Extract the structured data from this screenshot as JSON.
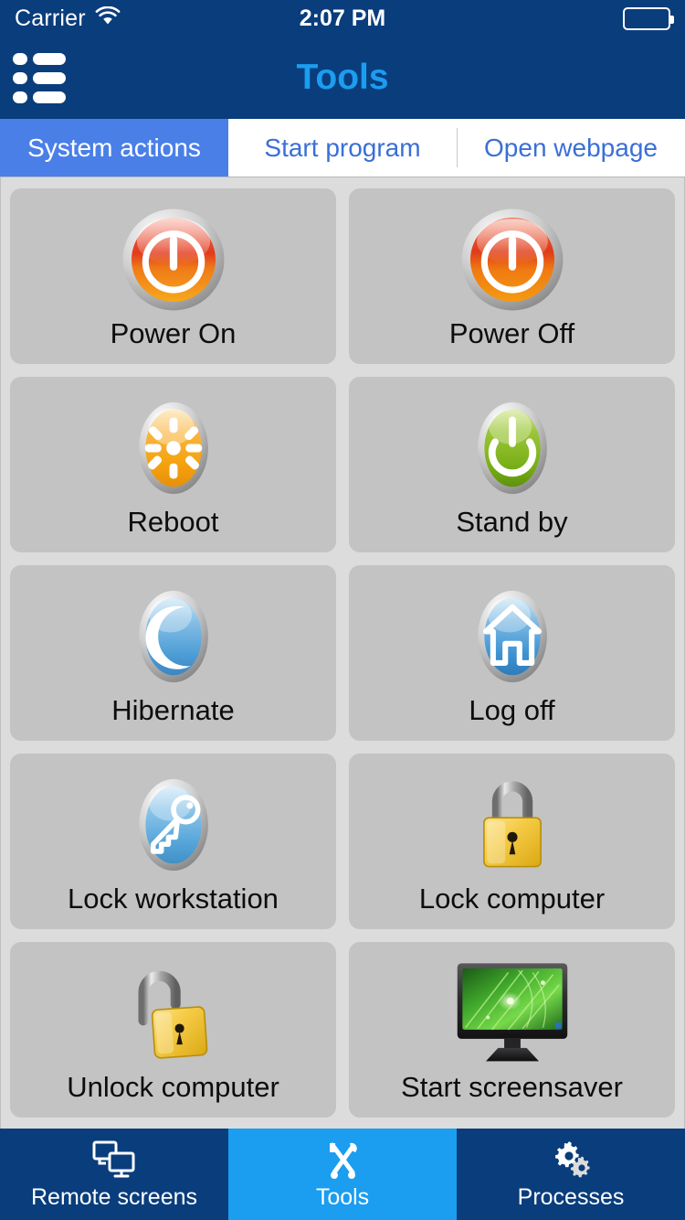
{
  "status_bar": {
    "carrier": "Carrier",
    "wifi_icon": "wifi-icon",
    "time": "2:07 PM",
    "battery_icon": "battery-full-icon"
  },
  "nav_bar": {
    "menu_icon": "list-menu-icon",
    "title": "Tools"
  },
  "segmented_tabs": {
    "active_index": 0,
    "items": [
      {
        "label": "System actions"
      },
      {
        "label": "Start program"
      },
      {
        "label": "Open webpage"
      }
    ]
  },
  "actions": [
    {
      "label": "Power On",
      "icon": "power-on-icon"
    },
    {
      "label": "Power Off",
      "icon": "power-off-icon"
    },
    {
      "label": "Reboot",
      "icon": "reboot-sunburst-icon"
    },
    {
      "label": "Stand by",
      "icon": "standby-power-icon"
    },
    {
      "label": "Hibernate",
      "icon": "moon-icon"
    },
    {
      "label": "Log off",
      "icon": "home-icon"
    },
    {
      "label": "Lock workstation",
      "icon": "key-icon"
    },
    {
      "label": "Lock computer",
      "icon": "padlock-closed-icon"
    },
    {
      "label": "Unlock computer",
      "icon": "padlock-open-icon"
    },
    {
      "label": "Start screensaver",
      "icon": "monitor-screensaver-icon"
    }
  ],
  "bottom_tabs": {
    "active_index": 1,
    "items": [
      {
        "label": "Remote screens",
        "icon": "two-monitors-icon"
      },
      {
        "label": "Tools",
        "icon": "hammer-wrench-icon"
      },
      {
        "label": "Processes",
        "icon": "gears-icon"
      }
    ]
  },
  "colors": {
    "navy": "#0a3d7c",
    "title_blue": "#1b9df0",
    "tab_active_blue": "#4a7fe8",
    "tab_text_blue": "#3a6fd6",
    "content_bg": "#dcdcdc",
    "card_bg": "#c3c3c3"
  }
}
